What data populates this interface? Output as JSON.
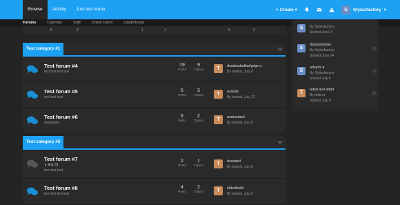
{
  "topnav": {
    "items": [
      "Browse",
      "Activity",
      "Just test menu"
    ],
    "create_label": "Create",
    "user_name": "Stylesfactory",
    "user_initial": "S"
  },
  "subnav": {
    "items": [
      "Forums",
      "Calendar",
      "Staff",
      "Online Users",
      "Leaderboard"
    ]
  },
  "stub_numbers": [
    "5",
    "2",
    "1",
    "1",
    "6",
    "3"
  ],
  "categories": [
    {
      "name": "Test category #1",
      "forums": [
        {
          "title": "Test forum #4",
          "desc": "test test test test",
          "posts": "19",
          "posts_label": "Posts",
          "topics": "9",
          "topics_label": "Topics",
          "last_avatar": "T",
          "last_title": "dsadsadadfasfgdgs a",
          "last_meta": "By testest, July 8"
        },
        {
          "title": "Test forum #5",
          "desc": "test test test",
          "posts": "6",
          "posts_label": "Posts",
          "topics": "3",
          "topics_label": "Topics",
          "last_avatar": "T",
          "last_title": "asdads",
          "last_meta": "By testest, July 12"
        },
        {
          "title": "Test forum #6",
          "desc": "dasdasda",
          "posts": "6",
          "posts_label": "Posts",
          "topics": "2",
          "topics_label": "Topics",
          "last_avatar": "T",
          "last_title": "asdasdasd",
          "last_meta": "By testest, July 8"
        }
      ]
    },
    {
      "name": "Test category #2",
      "forums": [
        {
          "title": "Test forum #7",
          "subforum": "↳ test 31",
          "desc": "test test test",
          "posts": "2",
          "posts_label": "Posts",
          "topics": "1",
          "topics_label": "Topics",
          "last_avatar": "T",
          "last_title": "dsadasd",
          "last_meta": "By testest, July 8"
        },
        {
          "title": "Test forum #8",
          "desc": "test test test test",
          "posts": "4",
          "posts_label": "Posts",
          "topics": "2",
          "topics_label": "Topics",
          "last_avatar": "T",
          "last_title": "sfdsdfsdfd",
          "last_meta": "By testest, July 9"
        }
      ]
    }
  ],
  "sidebar": {
    "items": [
      {
        "avatar": "S",
        "title": "",
        "by": "By Stylesfactory",
        "started": "Started June 3",
        "count": ""
      },
      {
        "avatar": "S",
        "title": "dasdasdsdas",
        "by": "By Stylesfactory",
        "started": "Started June 24",
        "count": "1"
      },
      {
        "avatar": "S",
        "title": "adsads a",
        "by": "By Stylesfactory",
        "started": "Started July 8",
        "count": "1"
      },
      {
        "avatar": "T",
        "title": "adad asd adad",
        "by": "By testest",
        "started": "Started July 9",
        "count": "0"
      }
    ]
  },
  "colors": {
    "accent": "#1da1f2",
    "background": "#242424",
    "panel": "#2a2a2a",
    "avatar_s": "#6b8ec7",
    "avatar_t": "#c98b5a"
  }
}
